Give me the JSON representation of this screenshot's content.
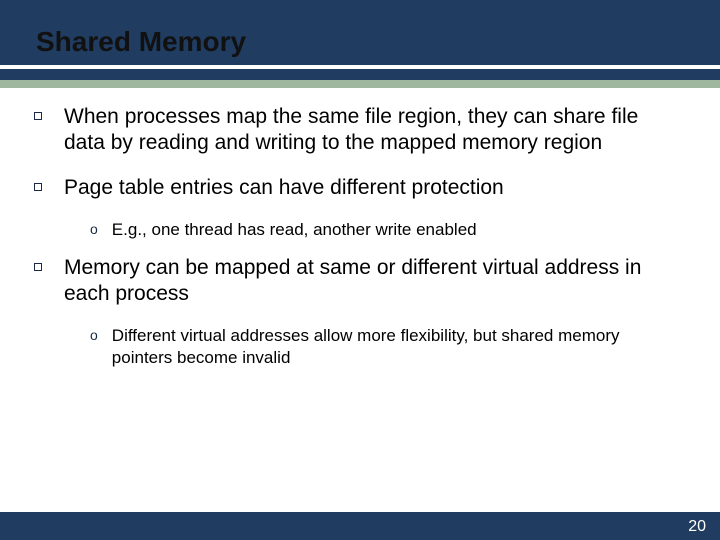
{
  "slide": {
    "title": "Shared Memory",
    "page_number": "20",
    "bullets": [
      {
        "text": "When processes map the same file region, they can share file data by reading and writing to the mapped memory region",
        "sub": []
      },
      {
        "text": "Page table entries can have different protection",
        "sub": [
          "E.g., one thread has read, another write enabled"
        ]
      },
      {
        "text": "Memory can be mapped at same or different virtual address in each process",
        "sub": [
          "Different virtual addresses allow more flexibility, but shared memory pointers become invalid"
        ]
      }
    ]
  }
}
